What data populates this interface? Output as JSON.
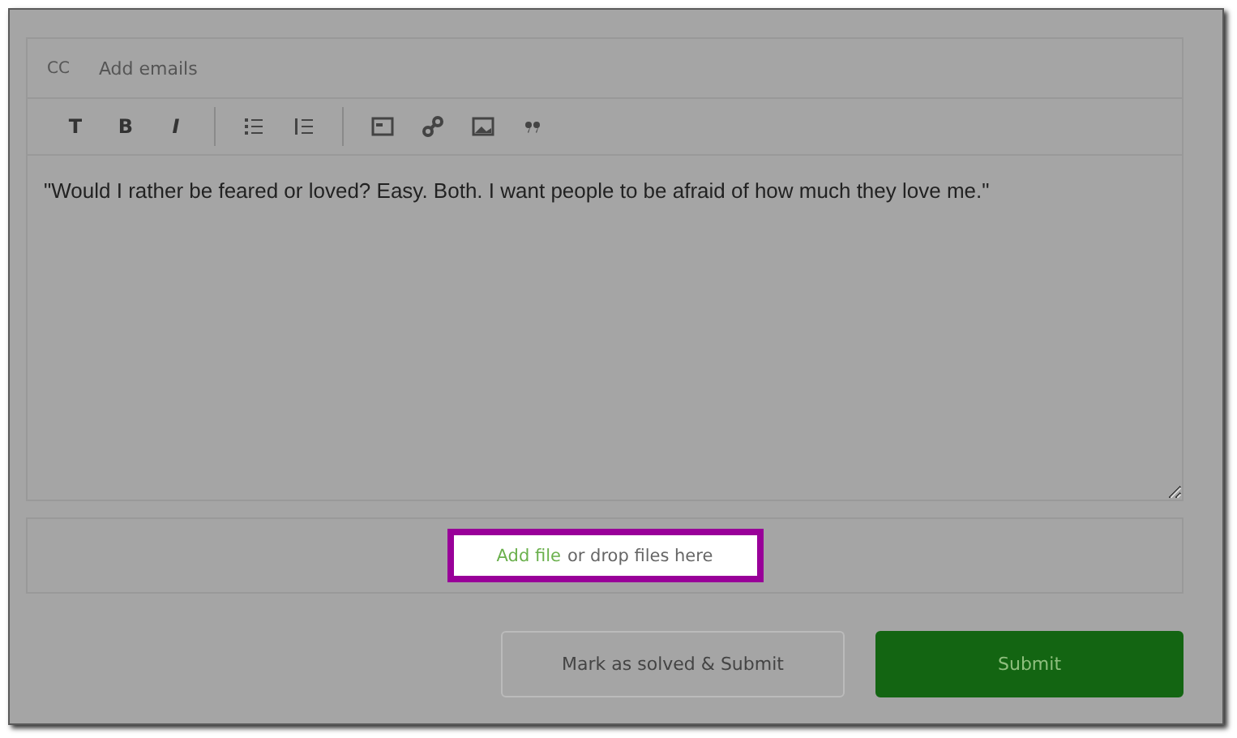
{
  "cc": {
    "label": "CC",
    "placeholder": "Add emails"
  },
  "toolbar": [
    {
      "kind": "letter",
      "text": "T"
    },
    {
      "kind": "letter",
      "text": "B"
    },
    {
      "kind": "letter",
      "text": "I",
      "italic": true
    },
    {
      "kind": "divider"
    },
    {
      "kind": "bullet-list"
    },
    {
      "kind": "numbered-list"
    },
    {
      "kind": "divider"
    },
    {
      "kind": "code-block"
    },
    {
      "kind": "link"
    },
    {
      "kind": "image"
    },
    {
      "kind": "quote"
    }
  ],
  "editor": {
    "value": "\"Would I rather be feared or loved? Easy. Both. I want people to be afraid of how much they love me.\""
  },
  "attachment": {
    "link": "Add file",
    "text": "or drop files here"
  },
  "buttons": [
    {
      "kind": "secondary",
      "label": "Mark as solved & Submit"
    },
    {
      "kind": "primary",
      "label": "Submit"
    }
  ]
}
